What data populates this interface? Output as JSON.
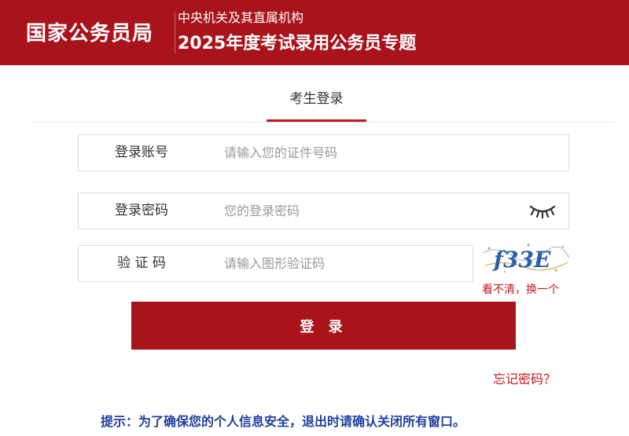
{
  "header": {
    "logo_text": "国家公务员局",
    "subtitle_line1": "中央机关及其直属机构",
    "subtitle_line2": "2025年度考试录用公务员专题",
    "brand_color": "#a9141c"
  },
  "tabs": [
    {
      "label": "考生登录",
      "active": true
    }
  ],
  "form": {
    "account": {
      "label": "登录账号",
      "value": "",
      "placeholder": "请输入您的证件号码"
    },
    "password": {
      "label": "登录密码",
      "value": "",
      "placeholder": "您的登录密码",
      "toggle_icon": "eye-closed-icon"
    },
    "captcha": {
      "label": "验 证 码",
      "value": "",
      "placeholder": "请输入图形验证码",
      "refresh_text": "看不清，换一个",
      "image_text": "f33E"
    },
    "submit_label": "登 录",
    "forgot_label": "忘记密码？"
  },
  "tip": "提示：为了确保您的个人信息安全，退出时请确认关闭所有窗口。",
  "colors": {
    "accent": "#c4161c",
    "tip_text": "#1f3f9e"
  }
}
